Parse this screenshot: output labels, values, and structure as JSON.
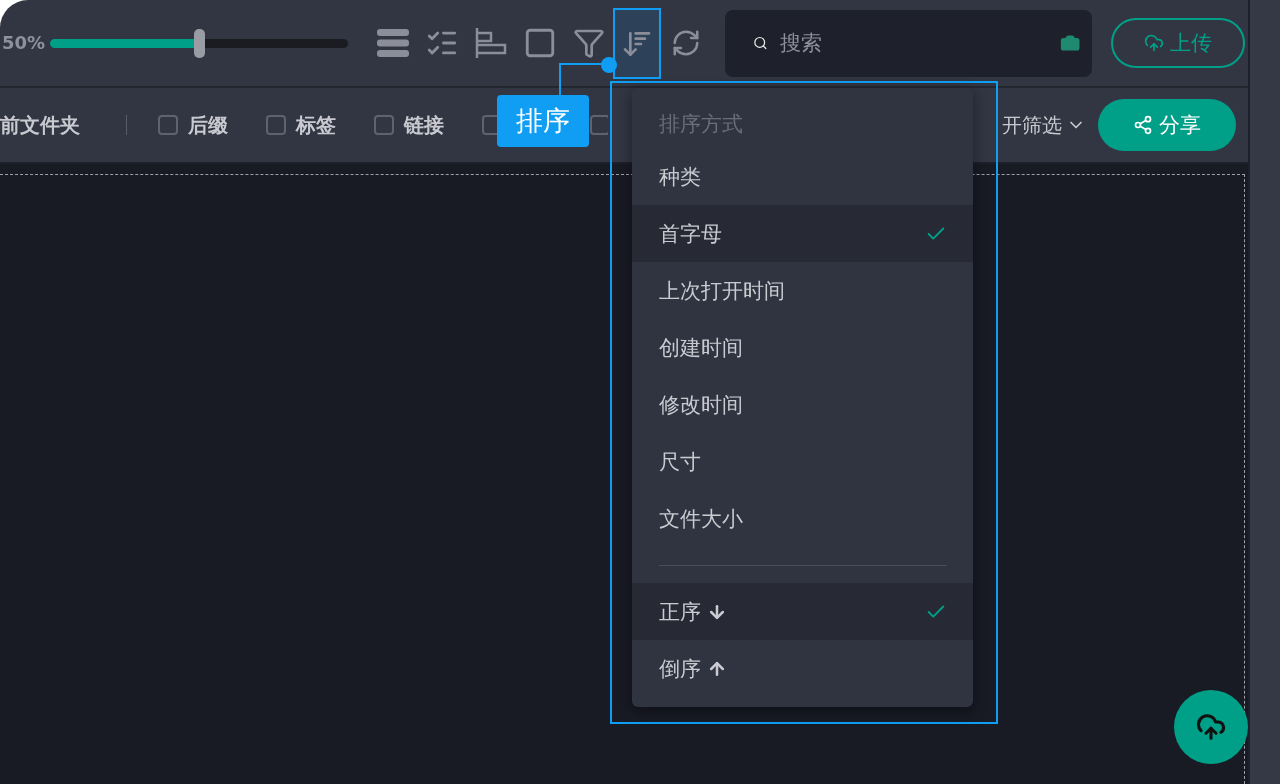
{
  "toolbar": {
    "zoom_label": "50%",
    "zoom_slider": {
      "level": 0.5
    },
    "tools": [
      {
        "kind": "list",
        "highlighted": false
      },
      {
        "kind": "checklist",
        "highlighted": false
      },
      {
        "kind": "align",
        "highlighted": false
      },
      {
        "kind": "square",
        "highlighted": false
      },
      {
        "kind": "filter",
        "highlighted": false
      },
      {
        "kind": "sort",
        "highlighted": true
      },
      {
        "kind": "refresh",
        "highlighted": false
      }
    ],
    "search": {
      "placeholder": "搜索"
    },
    "upload_button": {
      "label": "上传"
    }
  },
  "filter_bar": {
    "folder_label": "前文件夹",
    "options": [
      {
        "label": "后缀",
        "checked": false
      },
      {
        "label": "标签",
        "checked": false
      },
      {
        "label": "链接",
        "checked": false
      },
      {
        "checked": false
      },
      {
        "checked": false
      }
    ],
    "expand_filter": {
      "label": "开筛选"
    },
    "share_button": {
      "label": "分享"
    }
  },
  "sort_menu": {
    "header": "排序方式",
    "items": [
      {
        "label": "种类",
        "selected": false
      },
      {
        "label": "首字母",
        "selected": true
      },
      {
        "label": "上次打开时间",
        "selected": false
      },
      {
        "label": "创建时间",
        "selected": false
      },
      {
        "label": "修改时间",
        "selected": false
      },
      {
        "label": "尺寸",
        "selected": false
      },
      {
        "label": "文件大小",
        "selected": false
      }
    ],
    "order_items": [
      {
        "label": "正序",
        "kind": "descending",
        "selected": true
      },
      {
        "label": "倒序",
        "kind": "ascending",
        "selected": false
      }
    ]
  },
  "callout": {
    "label": "排序"
  }
}
